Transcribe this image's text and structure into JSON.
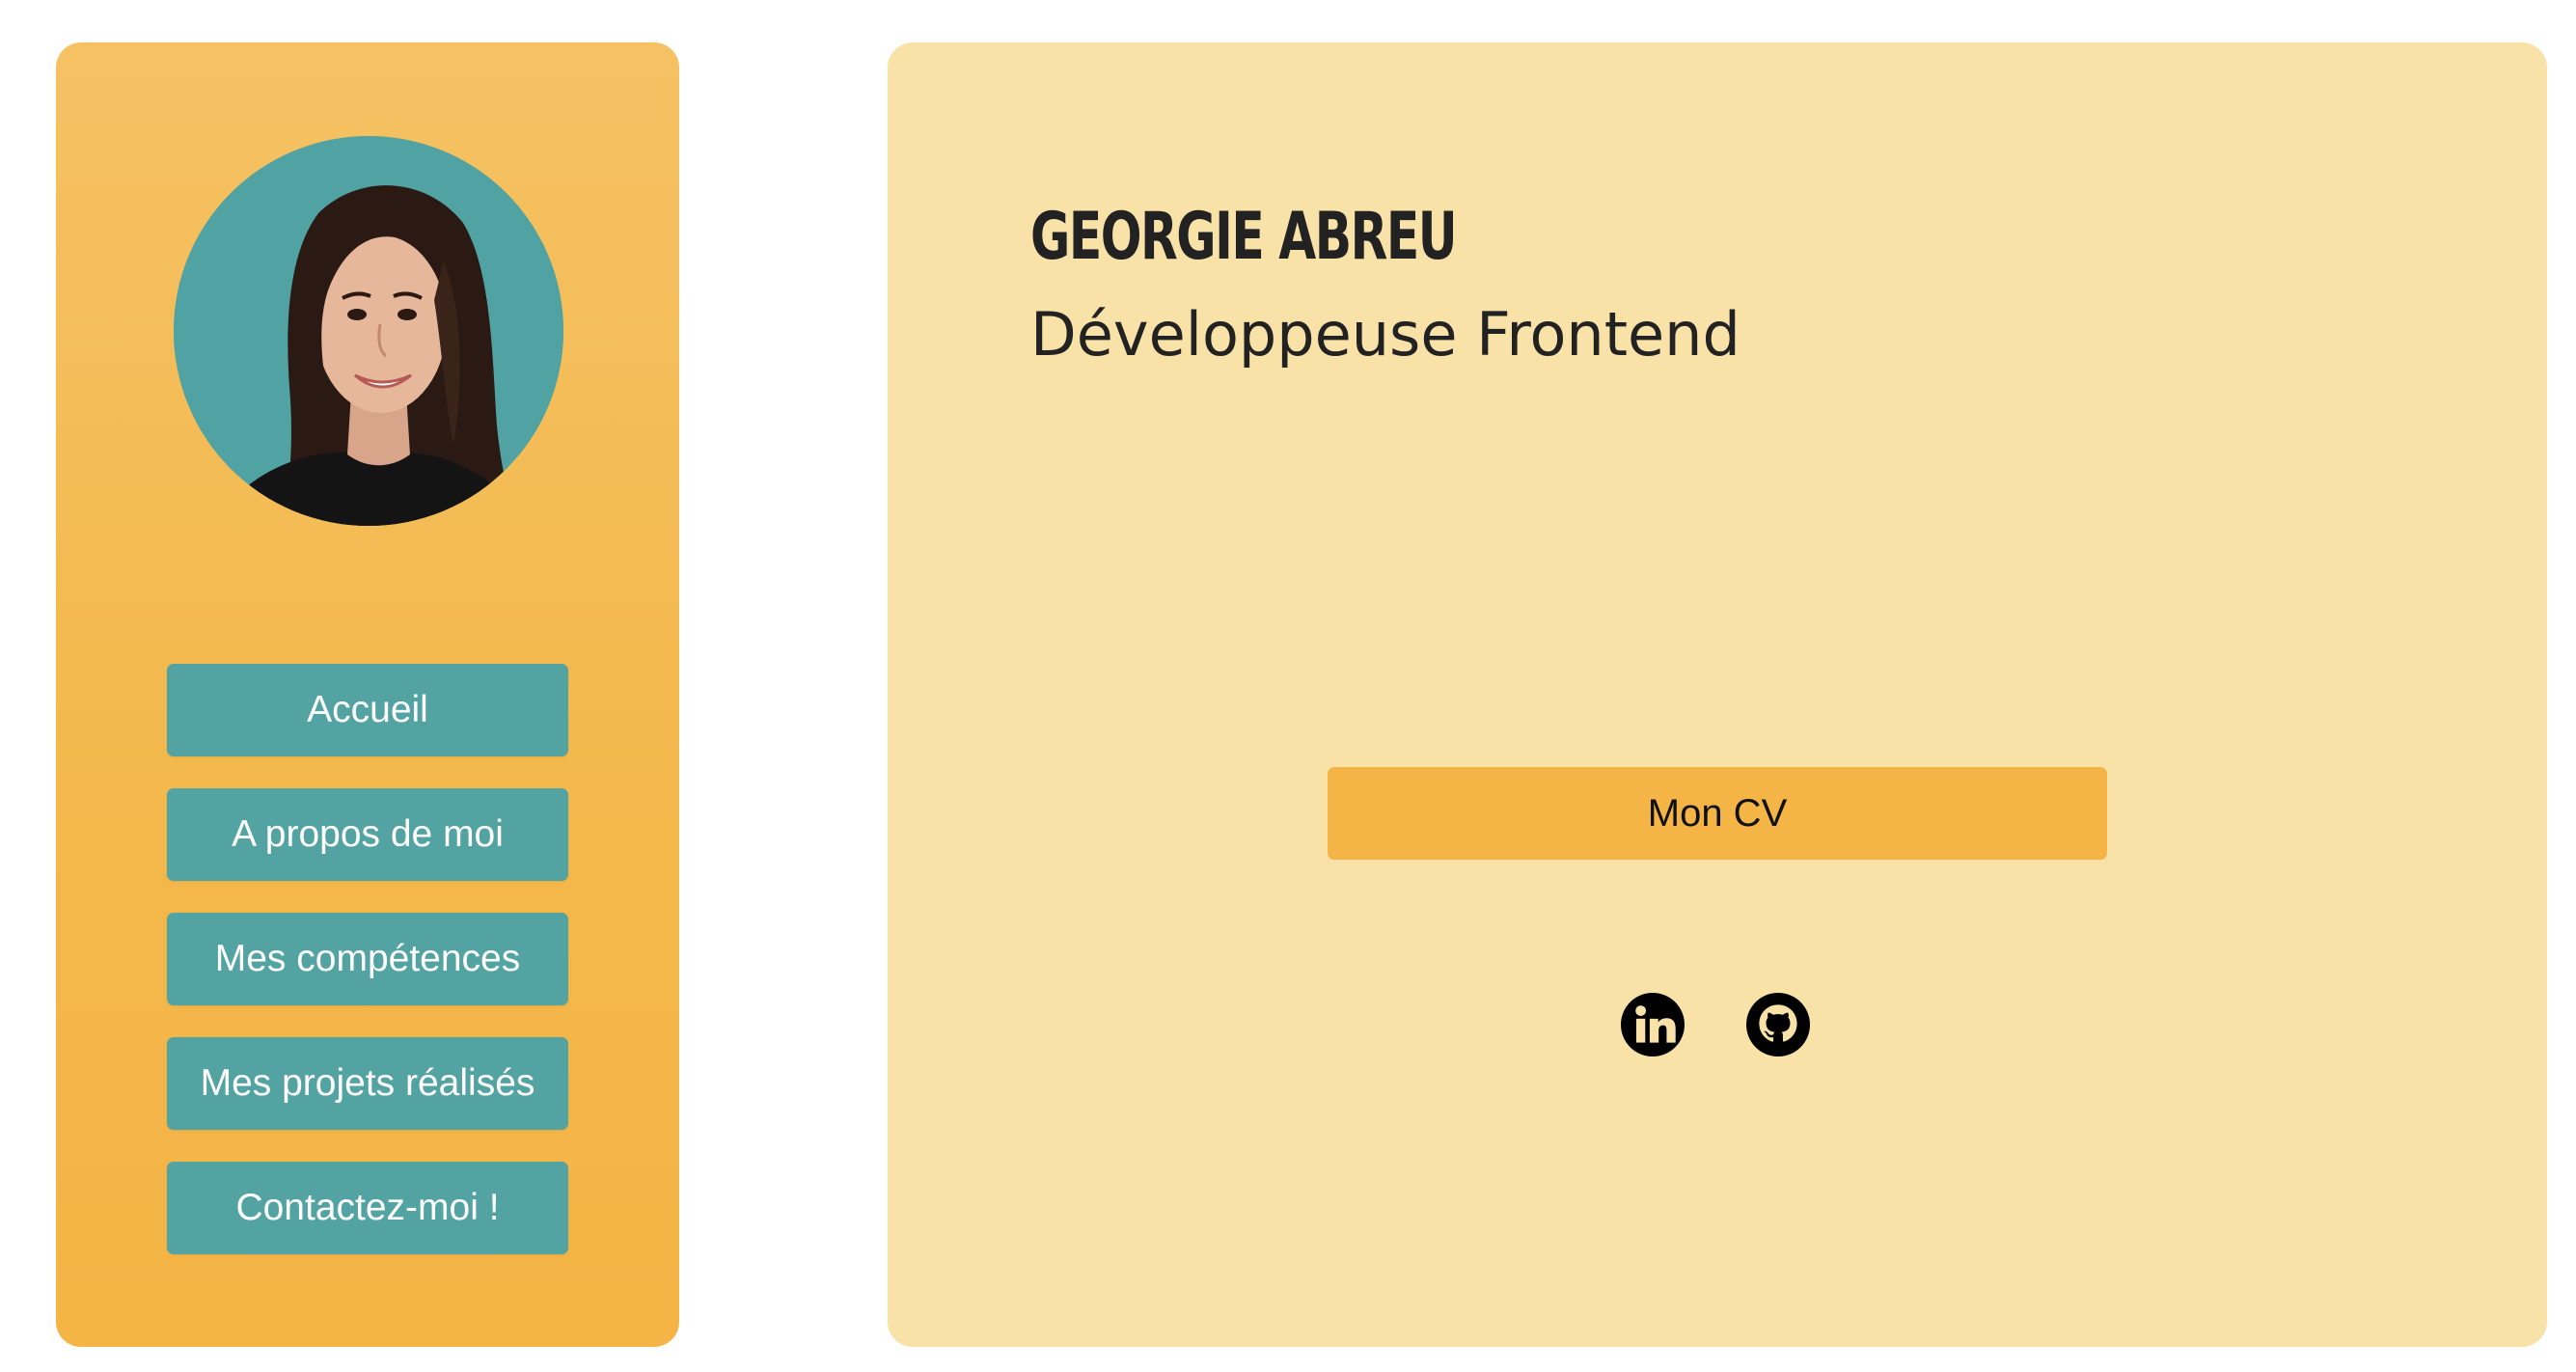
{
  "profile": {
    "avatar_icon": "profile-photo",
    "name": "GEORGIE ABREU",
    "role": "Développeuse Frontend"
  },
  "nav": {
    "items": [
      {
        "label": "Accueil"
      },
      {
        "label": "A propos de moi"
      },
      {
        "label": "Mes compétences"
      },
      {
        "label": "Mes projets réalisés"
      },
      {
        "label": "Contactez-moi !"
      }
    ]
  },
  "main": {
    "cv_label": "Mon CV",
    "socials": [
      {
        "icon": "linkedin-icon"
      },
      {
        "icon": "github-icon"
      }
    ]
  },
  "colors": {
    "sidebar": "#f4b84b",
    "main_panel": "#f9e2a8",
    "nav_button": "#53a3a3",
    "cv_button": "#f4b446",
    "avatar_bg": "#51a3a3"
  }
}
